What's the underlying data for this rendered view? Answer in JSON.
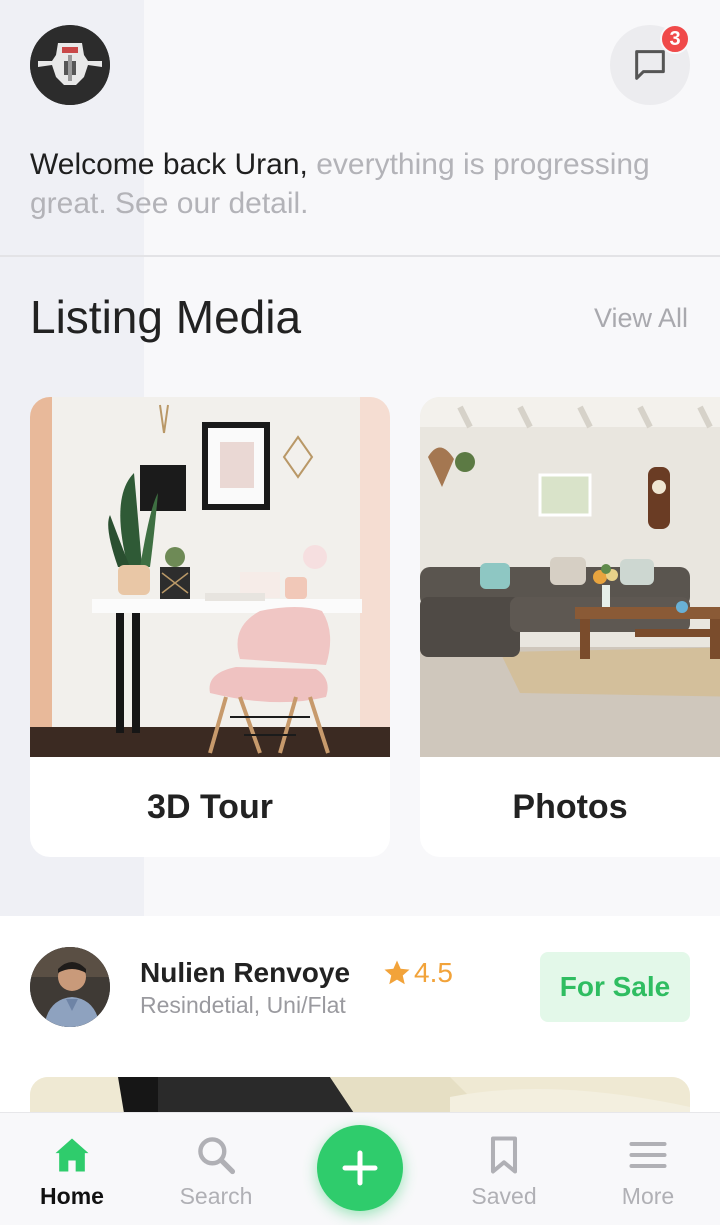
{
  "header": {
    "welcome_strong": "Welcome back Uran,",
    "welcome_muted": "everything is progressing great. See our detail.",
    "notification_count": "3"
  },
  "section": {
    "title": "Listing Media",
    "view_all": "View All"
  },
  "media_cards": [
    {
      "label": "3D Tour"
    },
    {
      "label": "Photos"
    }
  ],
  "listing": {
    "agent_name": "Nulien Renvoye",
    "rating": "4.5",
    "type": "Resindetial, Uni/Flat",
    "status": "For Sale"
  },
  "nav": {
    "items": [
      {
        "label": "Home",
        "icon": "home-icon"
      },
      {
        "label": "Search",
        "icon": "search-icon"
      },
      {
        "label": "Saved",
        "icon": "bookmark-icon"
      },
      {
        "label": "More",
        "icon": "menu-icon"
      }
    ],
    "fab_icon": "plus-icon"
  },
  "colors": {
    "accent": "#2fcc6c",
    "badge": "#f04a4a",
    "rating": "#f2a33a",
    "tag_bg": "#e3f8e9",
    "tag_text": "#2fbd61"
  }
}
